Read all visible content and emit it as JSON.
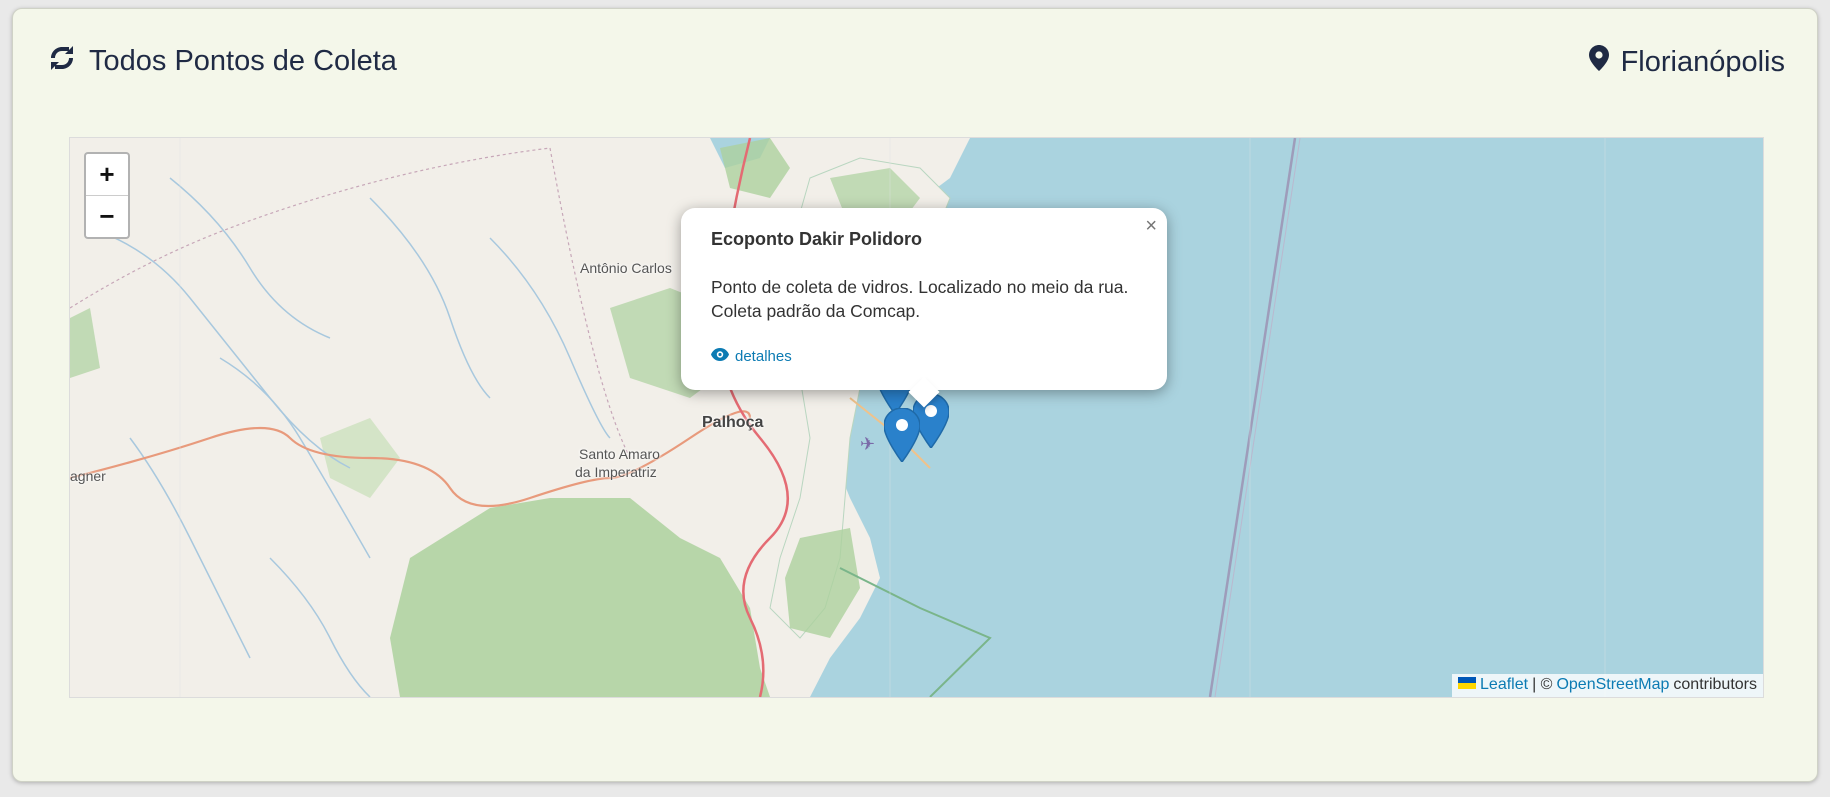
{
  "header": {
    "title": "Todos Pontos de Coleta",
    "title_icon": "recycle-icon",
    "city": "Florianópolis",
    "city_icon": "location-pin-icon"
  },
  "map": {
    "zoom_in_label": "+",
    "zoom_out_label": "−",
    "place_labels": {
      "antonio_carlos": "Antônio Carlos",
      "palhoca": "Palhoça",
      "santo_amaro_1": "Santo Amaro",
      "santo_amaro_2": "da Imperatriz",
      "agner": "agner"
    },
    "popup": {
      "title": "Ecoponto Dakir Polidoro",
      "description": "Ponto de coleta de vidros. Localizado no meio da rua. Coleta padrão da Comcap.",
      "link_label": "detalhes",
      "link_icon": "eye-icon",
      "close_label": "×"
    },
    "attribution": {
      "leaflet_label": "Leaflet",
      "separator": "| ©",
      "osm_label": "OpenStreetMap",
      "contributors_label": "contributors"
    },
    "colors": {
      "water": "#aad3df",
      "land": "#f2efe9",
      "forest": "#add19e",
      "marker": "#2a81cb",
      "link": "#0c7bb3"
    }
  }
}
